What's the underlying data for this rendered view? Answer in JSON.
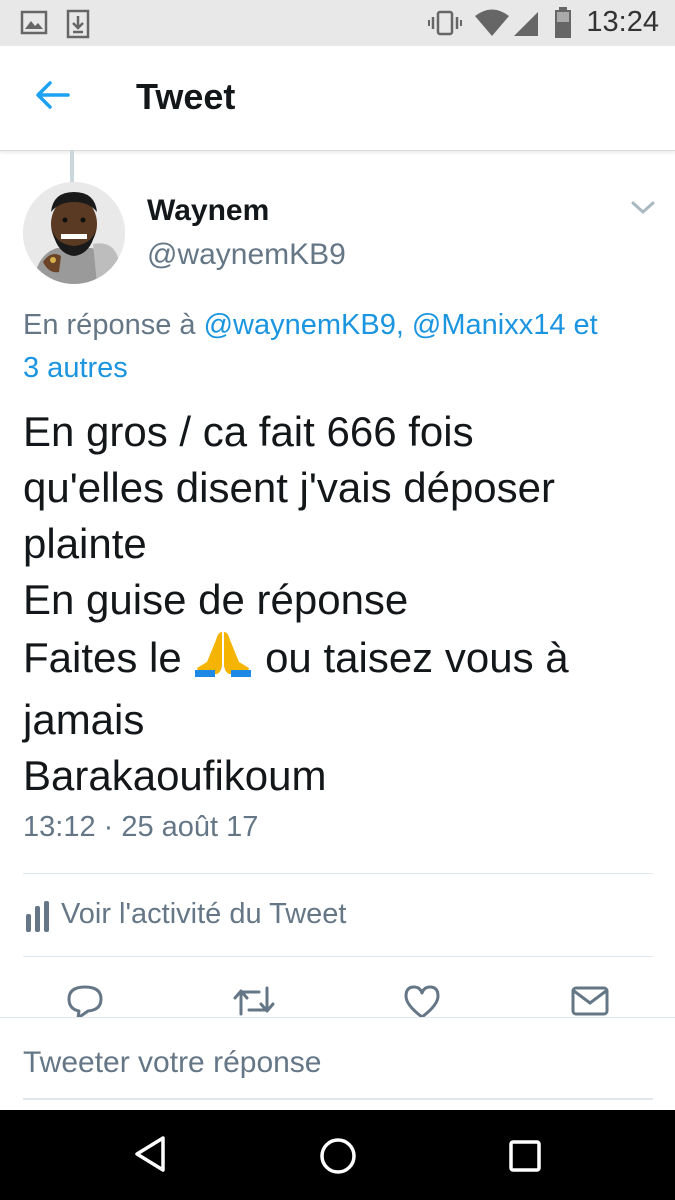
{
  "status_bar": {
    "time": "13:24",
    "icons": [
      "image-icon",
      "download-icon",
      "vibrate-icon",
      "wifi-icon",
      "signal-icon",
      "battery-icon"
    ]
  },
  "app_bar": {
    "title": "Tweet",
    "back_icon": "back-arrow-icon",
    "accent_color": "#1da1f2"
  },
  "tweet": {
    "author_name": "Waynem",
    "author_handle": "@waynemKB9",
    "reply_prefix": "En réponse à",
    "reply_mentions": "@waynemKB9, @Manixx14 et",
    "reply_others": "3 autres",
    "lines": [
      "En gros / ca fait 666 fois",
      "qu'elles disent j'vais déposer",
      "plainte",
      "En guise de réponse",
      "Faites le",
      "ou taisez vous à",
      "jamais",
      "Barakaoufikoum"
    ],
    "emoji": "folded-hands",
    "timestamp": "13:12 · 25 août 17"
  },
  "activity": {
    "label": "Voir l'activité du Tweet",
    "icon": "bar-chart-icon"
  },
  "actions": [
    "reply-icon",
    "retweet-icon",
    "like-icon",
    "message-icon"
  ],
  "reply_box": {
    "placeholder": "Tweeter votre réponse"
  },
  "nav_bar": {
    "icons": [
      "back-triangle-icon",
      "home-circle-icon",
      "recents-square-icon"
    ]
  },
  "colors": {
    "link": "#1b95e0",
    "secondary_text": "#657786",
    "primary_text": "#14171a"
  }
}
